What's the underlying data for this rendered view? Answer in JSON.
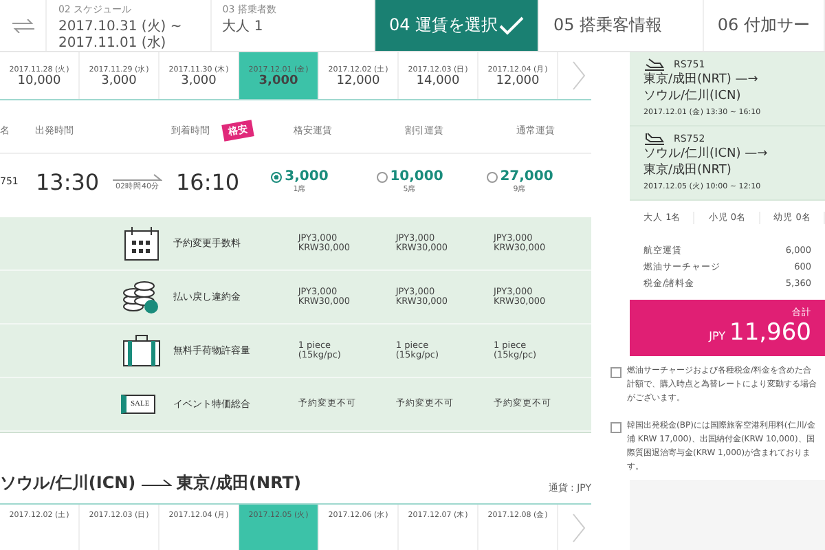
{
  "steps": [
    {
      "number": "02",
      "label": "スケジュール",
      "value": "2017.10.31 (火) ~ 2017.11.01 (水)",
      "selected": false
    },
    {
      "number": "03",
      "label": "搭乗者数",
      "value": "大人 1",
      "selected": false
    },
    {
      "number": "04",
      "label": "運賃を選択",
      "selected": true
    },
    {
      "number": "05",
      "label": "搭乗客情報",
      "selected": false
    },
    {
      "number": "06",
      "label": "付加サー",
      "selected": false
    }
  ],
  "outbound": {
    "dates": [
      {
        "date": "2017.11.28 (火)",
        "price": "10,000",
        "selected": false
      },
      {
        "date": "2017.11.29 (水)",
        "price": "3,000",
        "selected": false
      },
      {
        "date": "2017.11.30 (木)",
        "price": "3,000",
        "selected": false
      },
      {
        "date": "2017.12.01 (金)",
        "price": "3,000",
        "selected": true
      },
      {
        "date": "2017.12.02 (土)",
        "price": "12,000",
        "selected": false
      },
      {
        "date": "2017.12.03 (日)",
        "price": "14,000",
        "selected": false
      },
      {
        "date": "2017.12.04 (月)",
        "price": "12,000",
        "selected": false
      }
    ],
    "columns": {
      "column_1": "名",
      "departure": "出発時間",
      "arrival": "到着時間",
      "badge": "格安",
      "fares": [
        "格安運賃",
        "割引運賃",
        "通常運賃"
      ]
    },
    "flight": {
      "number": "751",
      "departure": "13:30",
      "duration": "02時間40分",
      "arrival": "16:10",
      "fares": [
        {
          "price": "3,000",
          "seats": "1席",
          "selected": true
        },
        {
          "price": "10,000",
          "seats": "5席",
          "selected": false
        },
        {
          "price": "27,000",
          "seats": "9席",
          "selected": false
        }
      ]
    },
    "conditions": [
      {
        "kind": "calendar",
        "label": "予約変更手数料",
        "values": [
          "JPY3,000\nKRW30,000",
          "JPY3,000\nKRW30,000",
          "JPY3,000\nKRW30,000"
        ]
      },
      {
        "kind": "coins",
        "label": "払い戻し違約金",
        "values": [
          "JPY3,000\nKRW30,000",
          "JPY3,000\nKRW30,000",
          "JPY3,000\nKRW30,000"
        ]
      },
      {
        "kind": "suitcase",
        "label": "無料手荷物許容量",
        "values": [
          "1 piece\n(15kg/pc)",
          "1 piece\n(15kg/pc)",
          "1 piece\n(15kg/pc)"
        ]
      },
      {
        "kind": "sale",
        "label": "イベント特価総合",
        "sale_tag": "SALE",
        "values": [
          "予約変更不可",
          "予約変更不可",
          "予約変更不可"
        ]
      }
    ]
  },
  "return": {
    "route_from": "ソウル/仁川(ICN)",
    "route_to": "東京/成田(NRT)",
    "currency": "通貨 : JPY",
    "dates": [
      {
        "date": "2017.12.02 (土)",
        "selected": false
      },
      {
        "date": "2017.12.03 (日)",
        "selected": false
      },
      {
        "date": "2017.12.04 (月)",
        "selected": false
      },
      {
        "date": "2017.12.05 (火)",
        "selected": true
      },
      {
        "date": "2017.12.06 (水)",
        "selected": false
      },
      {
        "date": "2017.12.07 (木)",
        "selected": false
      },
      {
        "date": "2017.12.08 (金)",
        "selected": false
      }
    ]
  },
  "summary": {
    "flights": [
      {
        "kind": "depart",
        "number": "RS751",
        "from": "東京/成田(NRT) —→",
        "to": "ソウル/仁川(ICN)",
        "time": "2017.12.01 (金) 13:30 ~ 16:10"
      },
      {
        "kind": "arrive",
        "number": "RS752",
        "from": "ソウル/仁川(ICN) —→",
        "to": "東京/成田(NRT)",
        "time": "2017.12.05 (火) 10:00 ~ 12:10"
      }
    ],
    "passengers": [
      "大人 1名",
      "小児 0名",
      "幼児 0名"
    ],
    "charges": [
      {
        "label": "航空運賃",
        "amount": "6,000"
      },
      {
        "label": "燃油サーチャージ",
        "amount": "600"
      },
      {
        "label": "税金/諸料金",
        "amount": "5,360"
      }
    ],
    "total_label": "合計",
    "total_currency": "JPY",
    "total": "11,960",
    "notes": [
      "燃油サーチャージおよび各種税金/料金を含めた合計額で、購入時点と為替レートにより変動する場合がございます。",
      "韓国出発税金(BP)には国際旅客空港利用料(仁川/金浦 KRW 17,000)、出国納付金(KRW 10,000)、国際質困退治寄与金(KRW 1,000)が含まれております。"
    ]
  }
}
